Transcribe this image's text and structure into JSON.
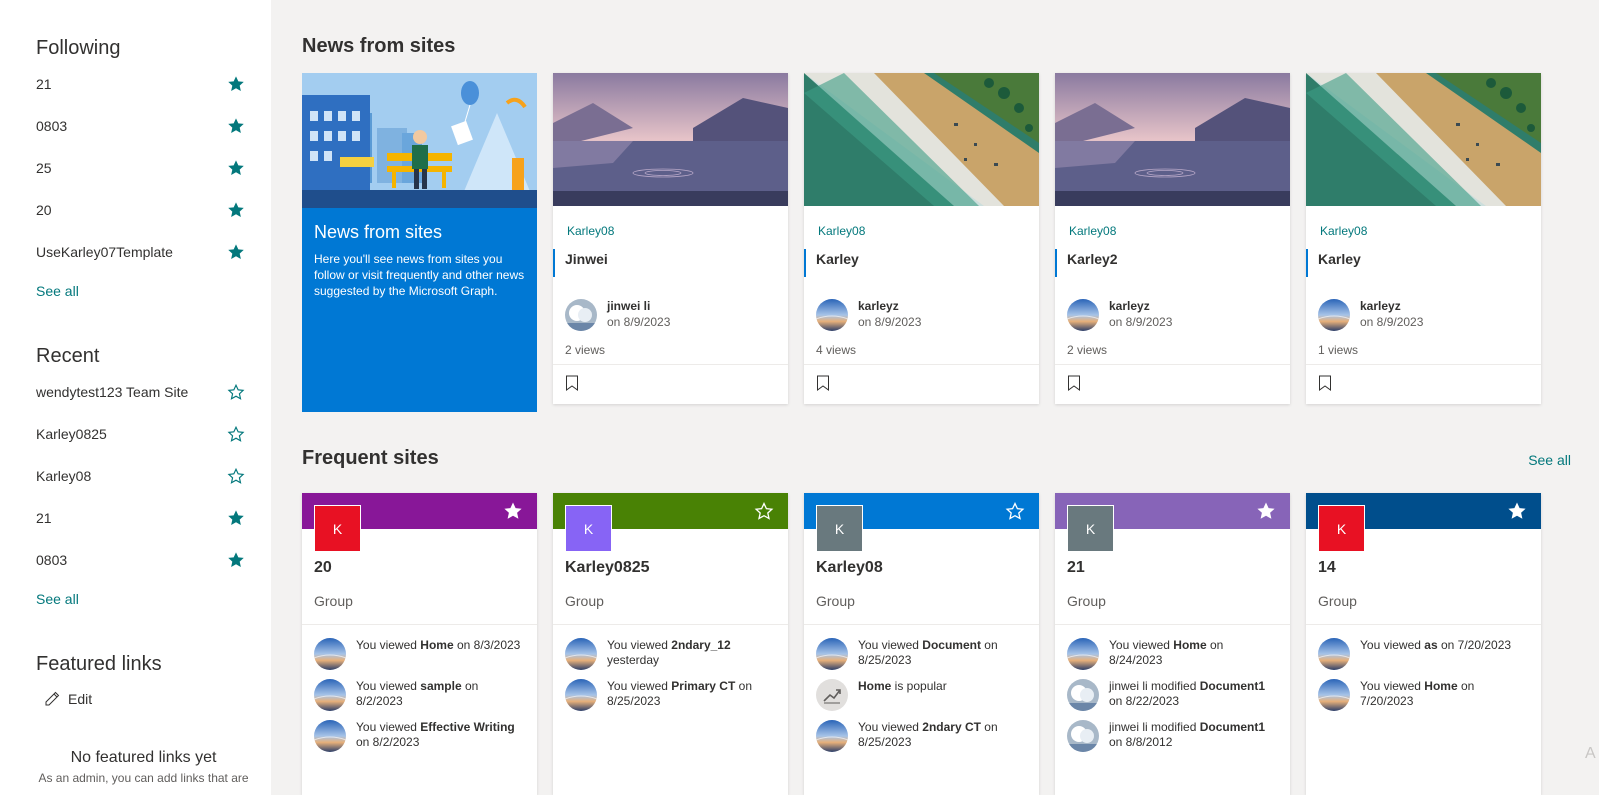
{
  "sidebar": {
    "following": {
      "title": "Following",
      "items": [
        {
          "label": "21",
          "starred": true
        },
        {
          "label": "0803",
          "starred": true
        },
        {
          "label": "25",
          "starred": true
        },
        {
          "label": "20",
          "starred": true
        },
        {
          "label": "UseKarley07Template",
          "starred": true
        }
      ],
      "see_all": "See all"
    },
    "recent": {
      "title": "Recent",
      "items": [
        {
          "label": "wendytest123 Team Site",
          "starred": false
        },
        {
          "label": "Karley0825",
          "starred": false
        },
        {
          "label": "Karley08",
          "starred": false
        },
        {
          "label": "21",
          "starred": true
        },
        {
          "label": "0803",
          "starred": true
        }
      ],
      "see_all": "See all"
    },
    "featured": {
      "title": "Featured links",
      "edit_label": "Edit",
      "empty_title": "No featured links yet",
      "empty_sub": "As an admin, you can add links that are"
    }
  },
  "news": {
    "title": "News from sites",
    "intro": {
      "title": "News from sites",
      "text": "Here you'll see news from sites you follow or visit frequently and other news suggested by the Microsoft Graph."
    },
    "cards": [
      {
        "site": "Karley08",
        "title": "Jinwei",
        "author": "jinwei li",
        "date": "on 8/9/2023",
        "views": "2 views",
        "image": "lake",
        "avatar": "cloud"
      },
      {
        "site": "Karley08",
        "title": "Karley",
        "author": "karleyz",
        "date": "on 8/9/2023",
        "views": "4 views",
        "image": "beach",
        "avatar": "globe"
      },
      {
        "site": "Karley08",
        "title": "Karley2",
        "author": "karleyz",
        "date": "on 8/9/2023",
        "views": "2 views",
        "image": "lake",
        "avatar": "globe"
      },
      {
        "site": "Karley08",
        "title": "Karley",
        "author": "karleyz",
        "date": "on 8/9/2023",
        "views": "1 views",
        "image": "beach",
        "avatar": "globe"
      }
    ]
  },
  "frequent": {
    "title": "Frequent sites",
    "see_all": "See all",
    "sites": [
      {
        "initial": "K",
        "name": "20",
        "type": "Group",
        "band_color": "#881798",
        "logo_color": "#e81123",
        "starred": true,
        "activities": [
          {
            "pre": "You viewed ",
            "bold": "Home",
            "post": " on 8/3/2023",
            "icon": "globe"
          },
          {
            "pre": "You viewed ",
            "bold": "sample",
            "post": " on 8/2/2023",
            "icon": "globe"
          },
          {
            "pre": "You viewed ",
            "bold": "Effective Writing",
            "post": " on 8/2/2023",
            "icon": "globe"
          }
        ]
      },
      {
        "initial": "K",
        "name": "Karley0825",
        "type": "Group",
        "band_color": "#498205",
        "logo_color": "#8764f5",
        "starred": false,
        "activities": [
          {
            "pre": "You viewed ",
            "bold": "2ndary_12",
            "post": " yesterday",
            "icon": "globe"
          },
          {
            "pre": "You viewed ",
            "bold": "Primary CT",
            "post": " on 8/25/2023",
            "icon": "globe"
          }
        ]
      },
      {
        "initial": "K",
        "name": "Karley08",
        "type": "Group",
        "band_color": "#0078d4",
        "logo_color": "#69797e",
        "starred": false,
        "activities": [
          {
            "pre": "You viewed ",
            "bold": "Document",
            "post": " on 8/25/2023",
            "icon": "globe"
          },
          {
            "pre": "",
            "bold": "Home",
            "post": " is popular",
            "icon": "trending"
          },
          {
            "pre": "You viewed ",
            "bold": "2ndary CT",
            "post": " on 8/25/2023",
            "icon": "globe"
          }
        ]
      },
      {
        "initial": "K",
        "name": "21",
        "type": "Group",
        "band_color": "#8764b8",
        "logo_color": "#69797e",
        "starred": true,
        "activities": [
          {
            "pre": "You viewed ",
            "bold": "Home",
            "post": " on 8/24/2023",
            "icon": "globe"
          },
          {
            "pre": "jinwei li modified ",
            "bold": "Document1",
            "post": " on 8/22/2023",
            "icon": "cloud"
          },
          {
            "pre": "jinwei li modified ",
            "bold": "Document1",
            "post": " on 8/8/2012",
            "icon": "cloud"
          }
        ]
      },
      {
        "initial": "K",
        "name": "14",
        "type": "Group",
        "band_color": "#004e8c",
        "logo_color": "#e81123",
        "starred": true,
        "activities": [
          {
            "pre": "You viewed ",
            "bold": "as",
            "post": " on 7/20/2023",
            "icon": "globe"
          },
          {
            "pre": "You viewed ",
            "bold": "Home",
            "post": " on 7/20/2023",
            "icon": "globe"
          }
        ]
      }
    ]
  },
  "colors": {
    "accent": "#03787c",
    "brand_blue": "#0078d4"
  },
  "corner_text": "A"
}
